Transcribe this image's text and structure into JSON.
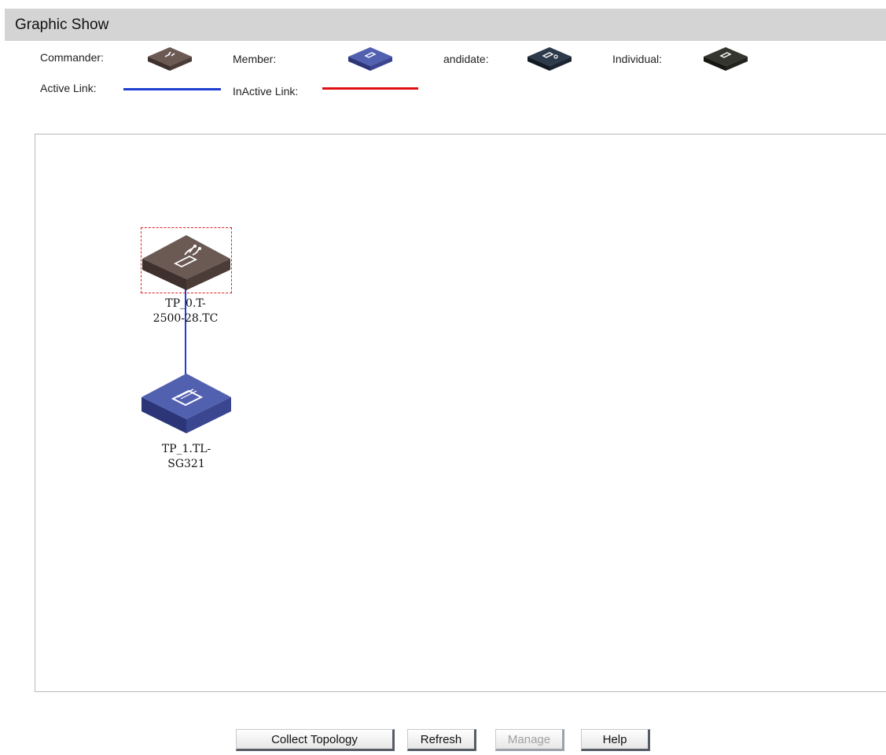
{
  "header": {
    "title": "Graphic Show"
  },
  "legend": {
    "commander_label": "Commander:",
    "member_label": "Member:",
    "candidate_label": "andidate:",
    "individual_label": "Individual:",
    "active_link_label": "Active Link:",
    "inactive_link_label": "InActive Link:",
    "colors": {
      "commander": "#5b4a45",
      "member": "#3d4a9a",
      "candidate": "#1f2a38",
      "individual": "#232520",
      "active_link": "#1e3fd0",
      "inactive_link": "#e01010"
    }
  },
  "topology": {
    "nodes": [
      {
        "role": "commander",
        "label_line1": "TP_0.T-",
        "label_line2": "2500-28.TC",
        "icon": "commander-switch-icon",
        "selected": true
      },
      {
        "role": "member",
        "label_line1": "TP_1.TL-",
        "label_line2": "SG321",
        "icon": "member-switch-icon",
        "selected": false
      }
    ],
    "links": [
      {
        "from": "TP_0",
        "to": "TP_1",
        "state": "active"
      }
    ]
  },
  "buttons": {
    "collect_topology": "Collect Topology",
    "refresh": "Refresh",
    "manage": "Manage",
    "help": "Help"
  }
}
